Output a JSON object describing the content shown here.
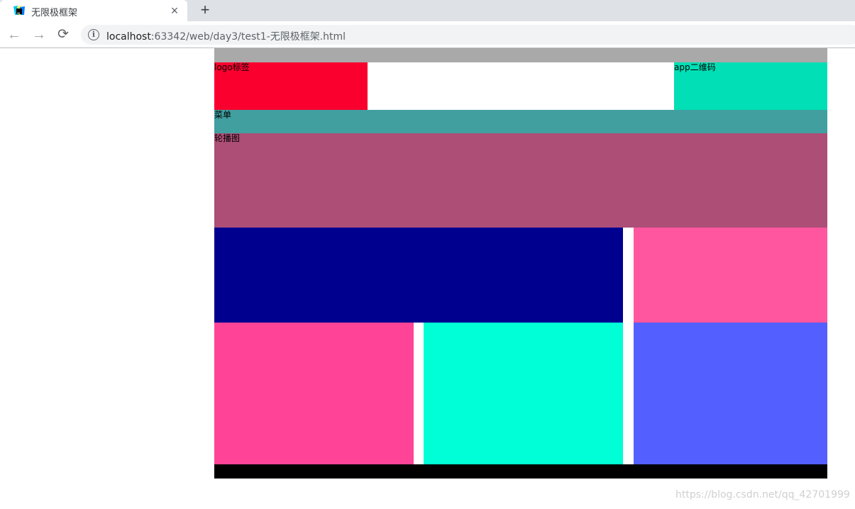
{
  "browser": {
    "tab": {
      "title": "无限极框架",
      "close": "×",
      "favicon": "webstorm-icon"
    },
    "new_tab": "+",
    "nav": {
      "back": "←",
      "forward": "→",
      "reload": "⟳"
    },
    "address": {
      "host": "localhost",
      "path": ":63342/web/day3/test1-无限极框架.html",
      "info": "i"
    }
  },
  "page": {
    "topbar": {
      "text": "",
      "color": "#a9a9a9"
    },
    "logo": {
      "text": "logo标签",
      "color": "#f9002f"
    },
    "header_mid": {
      "text": "",
      "color": "#ffffff"
    },
    "appqr": {
      "text": "app二维码",
      "color": "#00dfb5"
    },
    "menu": {
      "text": "菜单",
      "color": "#419fa0"
    },
    "carousel": {
      "text": "轮播图",
      "color": "#ac4e76"
    },
    "content_big": {
      "text": "",
      "color": "#00008f"
    },
    "content_right_top": {
      "text": "",
      "color": "#ff569f"
    },
    "content_pink": {
      "text": "",
      "color": "#ff4498"
    },
    "content_cyan": {
      "text": "",
      "color": "#00ffd6"
    },
    "content_right_bottom": {
      "text": "",
      "color": "#545fff"
    },
    "footer": {
      "text": "",
      "color": "#000000"
    }
  },
  "watermark": "https://blog.csdn.net/qq_42701999"
}
